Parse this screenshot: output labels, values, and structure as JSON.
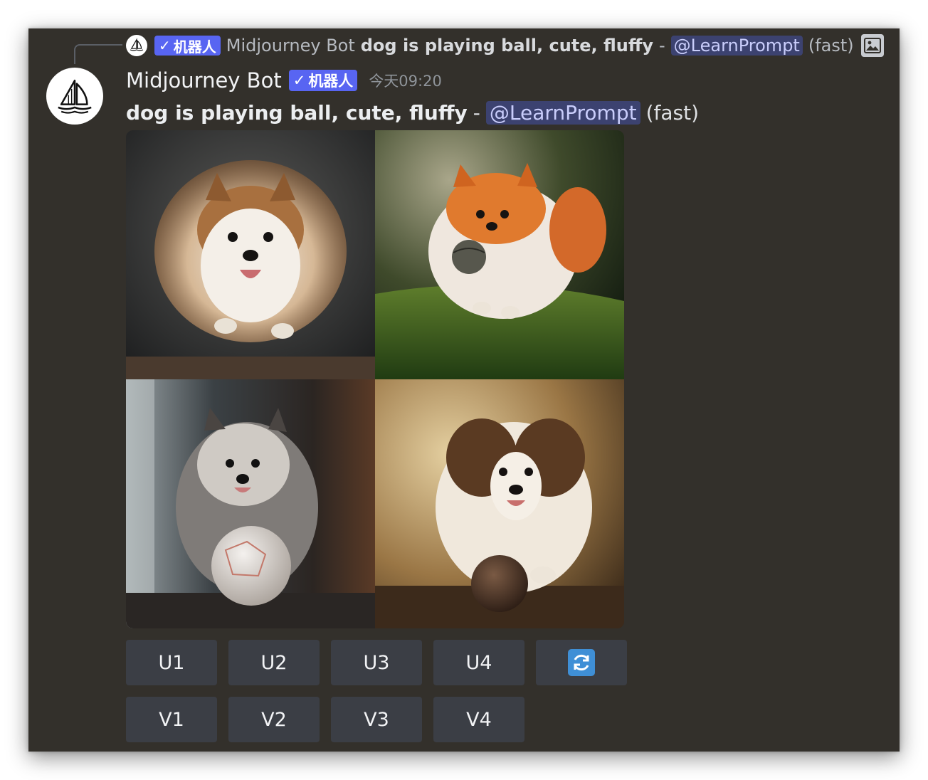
{
  "reply": {
    "bot_name": "Midjourney Bot",
    "badge_check": "✓",
    "badge_label": "机器人",
    "prompt": "dog is playing ball, cute, fluffy",
    "dash": "-",
    "mention": "@LearnPrompt",
    "mode": "(fast)",
    "image_icon": "image-icon"
  },
  "message": {
    "author": "Midjourney Bot",
    "badge_check": "✓",
    "badge_label": "机器人",
    "timestamp": "今天09:20",
    "prompt": "dog is playing ball, cute, fluffy",
    "dash": "-",
    "mention": "@LearnPrompt",
    "mode": "(fast)",
    "avatar_icon": "sailboat-icon"
  },
  "image_grid": {
    "images": [
      {
        "subject": "fluffy brown-white pomeranian leaping, dark studio"
      },
      {
        "subject": "orange pomeranian running on grass with ball in mouth"
      },
      {
        "subject": "grey fluffy puppy with white soccer ball by window"
      },
      {
        "subject": "brown-white fluffy puppy with brown ball, dusty warm light"
      }
    ]
  },
  "buttons": {
    "upscale": [
      "U1",
      "U2",
      "U3",
      "U4"
    ],
    "variation": [
      "V1",
      "V2",
      "V3",
      "V4"
    ],
    "reroll_icon": "refresh-icon"
  },
  "colors": {
    "background": "#33302b",
    "badge": "#5865f2",
    "mention_bg": "#3c4270",
    "button": "#3b3e45",
    "reroll": "#3f8fd6"
  }
}
